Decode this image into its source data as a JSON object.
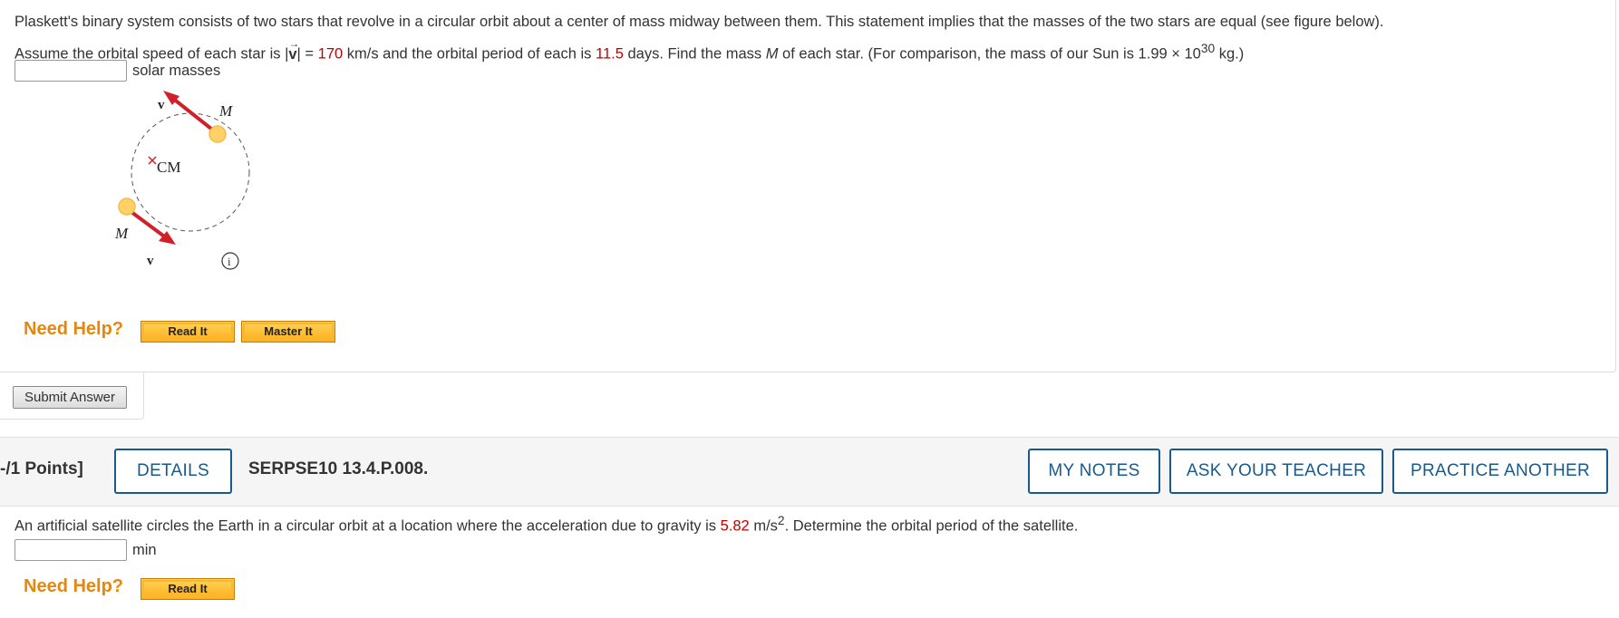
{
  "q1": {
    "text_before_vec": "Plaskett's binary system consists of two stars that revolve in a circular orbit about a center of mass midway between them. This statement implies that the masses of the two stars are equal (see figure below).",
    "line2_a": "Assume the orbital speed of each star is |",
    "vec_symbol": "v",
    "line2_b": "| = ",
    "speed_value": "170",
    "line2_c": " km/s and the orbital period of each is ",
    "period_value": "11.5",
    "line2_d": " days. Find the mass ",
    "mass_symbol": "M",
    "line2_e": " of each star. (For comparison, the mass of our Sun is 1.99 × 10",
    "exponent": "30",
    "line2_f": " kg.)",
    "answer_unit": "solar masses",
    "answer_value": "",
    "figure": {
      "label_top_v": "v",
      "label_top_m": "M",
      "label_cm": "CM",
      "label_bottom_m": "M",
      "label_bottom_v": "v",
      "info_glyph": "i"
    },
    "need_help": "Need Help?",
    "read_it": "Read It",
    "master_it": "Master It",
    "submit": "Submit Answer"
  },
  "q2_header": {
    "points": "-/1 Points]",
    "details": "DETAILS",
    "question_id": "SERPSE10 13.4.P.008.",
    "my_notes": "MY NOTES",
    "ask_teacher": "ASK YOUR TEACHER",
    "practice_another": "PRACTICE ANOTHER"
  },
  "q2": {
    "text_a": "An artificial satellite circles the Earth in a circular orbit at a location where the acceleration due to gravity is ",
    "g_value": "5.82",
    "text_b": " m/s",
    "g_exp": "2",
    "text_c": ". Determine the orbital period of the satellite.",
    "answer_unit": "min",
    "answer_value": "",
    "need_help": "Need Help?",
    "read_it": "Read It"
  },
  "colors": {
    "given_value": "#c00000",
    "help_orange": "#e8860c",
    "link_blue": "#1a5a8a",
    "arrow_red": "#d0202a",
    "star_yellow": "#ffd166"
  }
}
